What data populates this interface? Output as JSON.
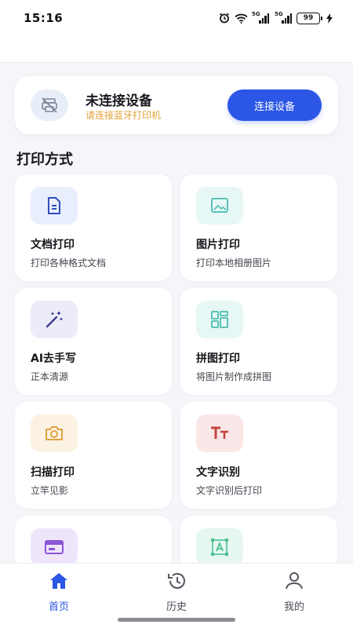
{
  "status_bar": {
    "time": "15:16",
    "signal_1_label": "5G",
    "signal_2_label": "5G",
    "battery": "99",
    "icons": [
      "alarm-icon",
      "wifi-icon",
      "signal-icon",
      "signal-icon",
      "battery-icon",
      "charging-icon"
    ]
  },
  "device": {
    "title": "未连接设备",
    "subtitle": "请连接蓝牙打印机",
    "connect_label": "连接设备",
    "icon": "printer-off-icon",
    "accent": "#2b56e6",
    "subtitle_color": "#e2a13a"
  },
  "section": {
    "title": "打印方式"
  },
  "cards": [
    {
      "title": "文档打印",
      "subtitle": "打印各种格式文档",
      "icon": "document-icon",
      "tile_color": "#e8eefc",
      "icon_color": "#2f4fb8"
    },
    {
      "title": "图片打印",
      "subtitle": "打印本地相册图片",
      "icon": "image-icon",
      "tile_color": "#e6f7f6",
      "icon_color": "#5cc2b4"
    },
    {
      "title": "AI去手写",
      "subtitle": "正本清源",
      "icon": "magic-wand-icon",
      "tile_color": "#ecebf8",
      "icon_color": "#3b3f8f"
    },
    {
      "title": "拼图打印",
      "subtitle": "将图片制作成拼图",
      "icon": "grid-icon",
      "tile_color": "#e6f7f6",
      "icon_color": "#5cc2b4"
    },
    {
      "title": "扫描打印",
      "subtitle": "立竿见影",
      "icon": "camera-icon",
      "tile_color": "#fcf2e3",
      "icon_color": "#e0a242"
    },
    {
      "title": "文字识别",
      "subtitle": "文字识别后打印",
      "icon": "text-icon",
      "tile_color": "#fbe7e7",
      "icon_color": "#c0453e"
    },
    {
      "title": "",
      "subtitle": "",
      "icon": "browser-window-icon",
      "tile_color": "#efe5fb",
      "icon_color": "#8b55d8"
    },
    {
      "title": "",
      "subtitle": "",
      "icon": "text-scan-icon",
      "tile_color": "#e6f7ef",
      "icon_color": "#4cbf95"
    }
  ],
  "tabs": [
    {
      "label": "首页",
      "icon": "home-icon",
      "active": true
    },
    {
      "label": "历史",
      "icon": "history-icon",
      "active": false
    },
    {
      "label": "我的",
      "icon": "user-icon",
      "active": false
    }
  ]
}
